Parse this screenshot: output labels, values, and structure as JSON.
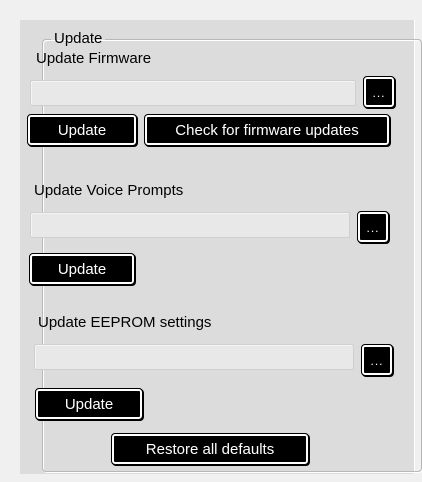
{
  "group": {
    "title": "Update"
  },
  "firmware": {
    "label": "Update Firmware",
    "path_value": "",
    "browse_label": "...",
    "update_label": "Update",
    "check_label": "Check for firmware updates"
  },
  "voice_prompts": {
    "label": "Update Voice Prompts",
    "path_value": "",
    "browse_label": "...",
    "update_label": "Update"
  },
  "eeprom": {
    "label": "Update EEPROM settings",
    "path_value": "",
    "browse_label": "...",
    "update_label": "Update",
    "restore_label": "Restore all defaults"
  }
}
